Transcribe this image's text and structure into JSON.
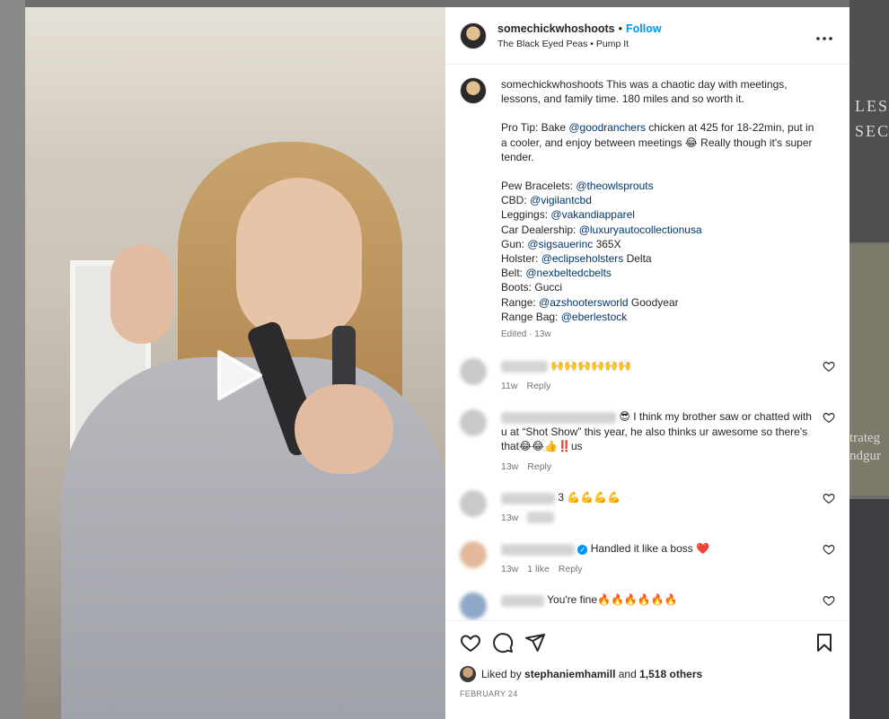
{
  "post": {
    "username": "somechickwhoshoots",
    "follow_label": "Follow",
    "separator": "•",
    "audio": "The Black Eyed Peas • Pump It",
    "more_icon": "more-horizontal-icon"
  },
  "caption": {
    "username": "somechickwhoshoots",
    "intro": "This was a chaotic day with meetings, lessons, and family time. 180 miles and so worth it.",
    "tip_prefix": "Pro Tip: Bake ",
    "tip_mention": "@goodranchers",
    "tip_suffix": " chicken at 425 for 18-22min, put in a cooler, and enjoy between meetings 😂 Really though it's super tender.",
    "gear": [
      {
        "label": "Pew Bracelets: ",
        "mention": "@theowlsprouts",
        "suffix": ""
      },
      {
        "label": "CBD: ",
        "mention": "@vigilantcbd",
        "suffix": ""
      },
      {
        "label": "Leggings: ",
        "mention": "@vakandiapparel",
        "suffix": ""
      },
      {
        "label": "Car Dealership: ",
        "mention": "@luxuryautocollectionusa",
        "suffix": ""
      },
      {
        "label": "Gun: ",
        "mention": "@sigsauerinc",
        "suffix": " 365X"
      },
      {
        "label": "Holster: ",
        "mention": "@eclipseholsters",
        "suffix": " Delta"
      },
      {
        "label": "Belt: ",
        "mention": "@nexbeltedcbelts",
        "suffix": ""
      },
      {
        "label": "Boots: Gucci",
        "mention": "",
        "suffix": ""
      },
      {
        "label": "Range: ",
        "mention": "@azshootersworld",
        "suffix": " Goodyear"
      },
      {
        "label": "Range Bag: ",
        "mention": "@eberlestock",
        "suffix": ""
      }
    ],
    "meta": "Edited · 13w"
  },
  "comments": [
    {
      "text": "🙌🙌🙌🙌🙌🙌",
      "time": "11w",
      "likes": "",
      "reply": "Reply"
    },
    {
      "text": "😎 I think my brother saw or chatted with u at “Shot Show” this year, he also thinks ur awesome so there's that😂😂👍‼️us",
      "time": "13w",
      "likes": "",
      "reply": "Reply"
    },
    {
      "text": "3 💪💪💪💪",
      "time": "13w",
      "likes": "",
      "reply": ""
    },
    {
      "text": "Handled it like a boss ❤️",
      "time": "13w",
      "likes": "1 like",
      "reply": "Reply"
    },
    {
      "text": "You're fine🔥🔥🔥🔥🔥🔥",
      "time": "",
      "likes": "",
      "reply": ""
    }
  ],
  "actions": {
    "like_icon": "heart-icon",
    "comment_icon": "comment-icon",
    "share_icon": "send-icon",
    "save_icon": "bookmark-icon"
  },
  "liked_by": {
    "prefix": "Liked by ",
    "user": "stephaniemhamill",
    "middle": " and ",
    "others": "1,518 others"
  },
  "date": "FEBRUARY 24",
  "background": {
    "text1": "LES",
    "text2": "SEC",
    "text3": "trateg",
    "text4": "ndgur"
  }
}
